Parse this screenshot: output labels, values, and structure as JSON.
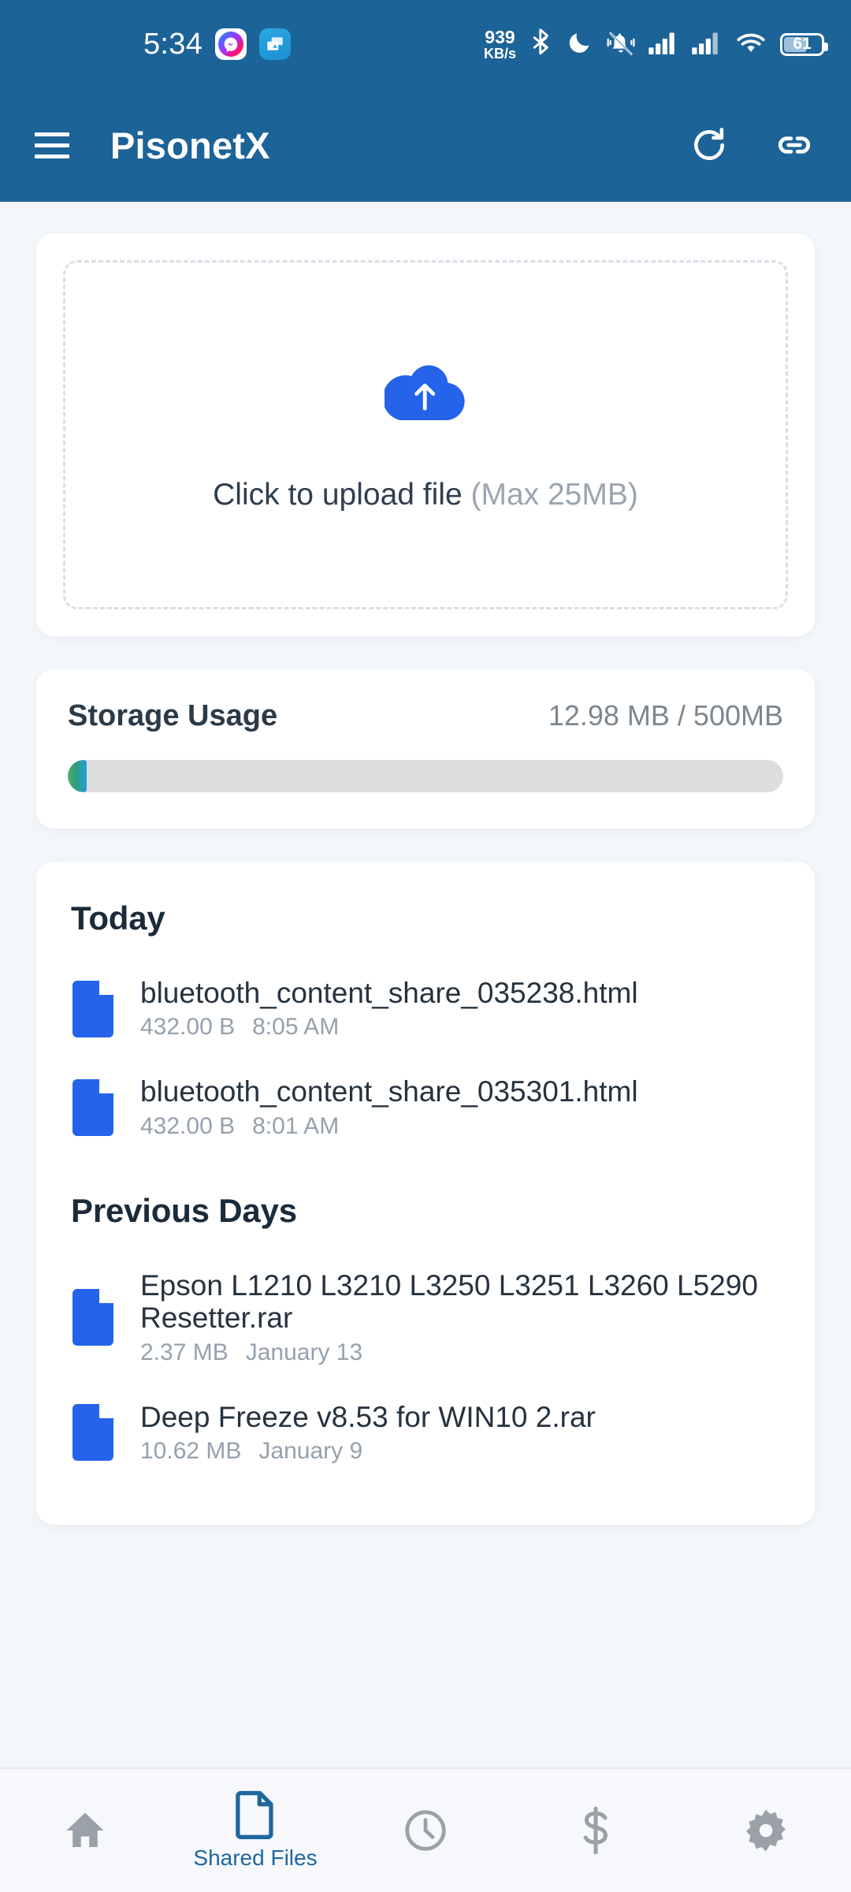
{
  "status_bar": {
    "time": "5:34",
    "app_icons": [
      "messenger-icon",
      "screen-cast-icon"
    ],
    "network_speed_value": "939",
    "network_speed_unit": "KB/s",
    "icons": [
      "bluetooth-icon",
      "do-not-disturb-moon-icon",
      "mute-bell-icon",
      "signal-bars-sim1-icon",
      "signal-bars-sim2-icon",
      "wifi-icon"
    ],
    "battery_percent": "61"
  },
  "app_bar": {
    "menu_icon": "hamburger-menu-icon",
    "title": "PisonetX",
    "refresh_icon": "refresh-icon",
    "link_icon": "link-icon"
  },
  "upload": {
    "icon": "cloud-upload-icon",
    "label": "Click to upload file",
    "limit": "(Max 25MB)"
  },
  "storage": {
    "title": "Storage Usage",
    "value": "12.98 MB / 500MB",
    "used_mb": 12.98,
    "total_mb": 500,
    "percent": 2.6,
    "fill_color_start": "#4caf66",
    "fill_color_end": "#1f9fe0",
    "track_color": "#dddddd"
  },
  "files": {
    "groups": [
      {
        "title": "Today",
        "items": [
          {
            "icon": "file-icon",
            "name": "bluetooth_content_share_035238.html",
            "size": "432.00 B",
            "time": "8:05 AM"
          },
          {
            "icon": "file-icon",
            "name": "bluetooth_content_share_035301.html",
            "size": "432.00 B",
            "time": "8:01 AM"
          }
        ]
      },
      {
        "title": "Previous Days",
        "items": [
          {
            "icon": "file-icon",
            "name": "Epson L1210 L3210 L3250 L3251 L3260 L5290 Resetter.rar",
            "size": "2.37 MB",
            "time": "January 13"
          },
          {
            "icon": "file-icon",
            "name": "Deep Freeze v8.53 for WIN10 2.rar",
            "size": "10.62 MB",
            "time": "January 9"
          }
        ]
      }
    ]
  },
  "bottom_nav": {
    "items": [
      {
        "icon": "home-icon",
        "label": "",
        "active": false
      },
      {
        "icon": "document-icon",
        "label": "Shared Files",
        "active": true
      },
      {
        "icon": "clock-icon",
        "label": "",
        "active": false
      },
      {
        "icon": "dollar-icon",
        "label": "",
        "active": false
      },
      {
        "icon": "gear-icon",
        "label": "",
        "active": false
      }
    ]
  },
  "theme": {
    "header_blue": "#1c6398",
    "accent_blue": "#2563eb",
    "nav_active_blue": "#1f679e",
    "page_bg": "#f4f7fa",
    "card_bg": "#ffffff"
  }
}
